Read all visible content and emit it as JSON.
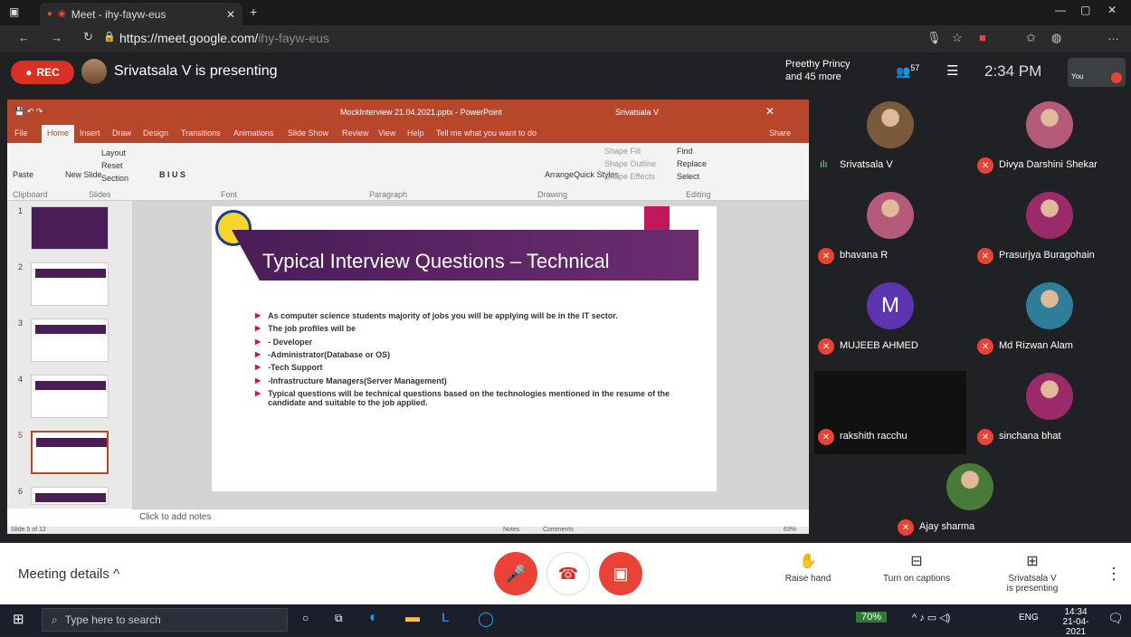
{
  "browser": {
    "tab_title": "Meet - ihy-fayw-eus",
    "url_host": "https://meet.google.com/",
    "url_path": "ihy-fayw-eus"
  },
  "meet_header": {
    "rec_label": "REC",
    "presenting_text": "Srivatsala V is presenting",
    "participants_text_line1": "Preethy Princy",
    "participants_text_line2": "and 45 more",
    "participant_count": "57",
    "time": "2:34 PM",
    "you_label": "You"
  },
  "powerpoint": {
    "file_title": "MockInterview 21.04.2021.pptx - PowerPoint",
    "user": "Srivatsala V",
    "tabs": [
      "File",
      "Home",
      "Insert",
      "Draw",
      "Design",
      "Transitions",
      "Animations",
      "Slide Show",
      "Review",
      "View",
      "Help"
    ],
    "tell_me": "Tell me what you want to do",
    "share": "Share",
    "ribbon_groups": [
      "Clipboard",
      "Slides",
      "Font",
      "Paragraph",
      "Drawing",
      "Editing"
    ],
    "ribbon_items": {
      "paste": "Paste",
      "new_slide": "New Slide",
      "layout": "Layout",
      "reset": "Reset",
      "section": "Section",
      "find": "Find",
      "replace": "Replace",
      "select": "Select",
      "arrange": "Arrange",
      "quick_styles": "Quick Styles",
      "shape_fill": "Shape Fill",
      "shape_outline": "Shape Outline",
      "shape_effects": "Shape Effects"
    },
    "slide_numbers": [
      "1",
      "2",
      "3",
      "4",
      "5",
      "6"
    ],
    "notes_placeholder": "Click to add notes",
    "status_slide": "Slide 5 of 12",
    "status_notes": "Notes",
    "status_comments": "Comments",
    "zoom": "63%"
  },
  "slide": {
    "title": "Typical Interview Questions – Technical",
    "bullets": [
      "As computer science students majority of jobs you will be applying will be in the IT sector.",
      "The job profiles will be",
      "- Developer",
      "-Administrator(Database or OS)",
      "-Tech Support",
      "-Infrastructure Managers(Server Management)",
      "Typical questions will be technical questions based on the technologies mentioned in the resume of the candidate and suitable to the job applied."
    ]
  },
  "participants": [
    {
      "name": "Srivatsala V",
      "speaking": true,
      "avatar": "photo",
      "color": "#7a5a3a"
    },
    {
      "name": "Divya Darshini Shekar",
      "speaking": false,
      "avatar": "photo",
      "color": "#b55a7a"
    },
    {
      "name": "bhavana R",
      "speaking": false,
      "avatar": "photo",
      "color": "#b55a7a"
    },
    {
      "name": "Prasurjya Buragohain",
      "speaking": false,
      "avatar": "photo",
      "color": "#9a2a6a"
    },
    {
      "name": "MUJEEB AHMED",
      "speaking": false,
      "avatar": "letter",
      "letter": "M",
      "color": "#5e35b1"
    },
    {
      "name": "Md Rizwan Alam",
      "speaking": false,
      "avatar": "photo",
      "color": "#2e7d9a"
    },
    {
      "name": "rakshith racchu",
      "speaking": false,
      "avatar": "none",
      "color": "#111"
    },
    {
      "name": "sinchana bhat",
      "speaking": false,
      "avatar": "photo",
      "color": "#9a2a6a"
    },
    {
      "name": "Ajay sharma",
      "speaking": false,
      "avatar": "photo",
      "color": "#4a7a3a"
    }
  ],
  "bottom_bar": {
    "meeting_details": "Meeting details",
    "raise_hand": "Raise hand",
    "captions": "Turn on captions",
    "presenting_line1": "Srivatsala V",
    "presenting_line2": "is presenting"
  },
  "taskbar": {
    "search_placeholder": "Type here to search",
    "battery": "70%",
    "lang": "ENG",
    "time": "14:34",
    "date": "21-04-2021"
  },
  "colors": {
    "meet_red": "#ea4335",
    "ppt_orange": "#b7472a",
    "slide_purple": "#4a1d57",
    "slide_accent": "#c2185b"
  }
}
